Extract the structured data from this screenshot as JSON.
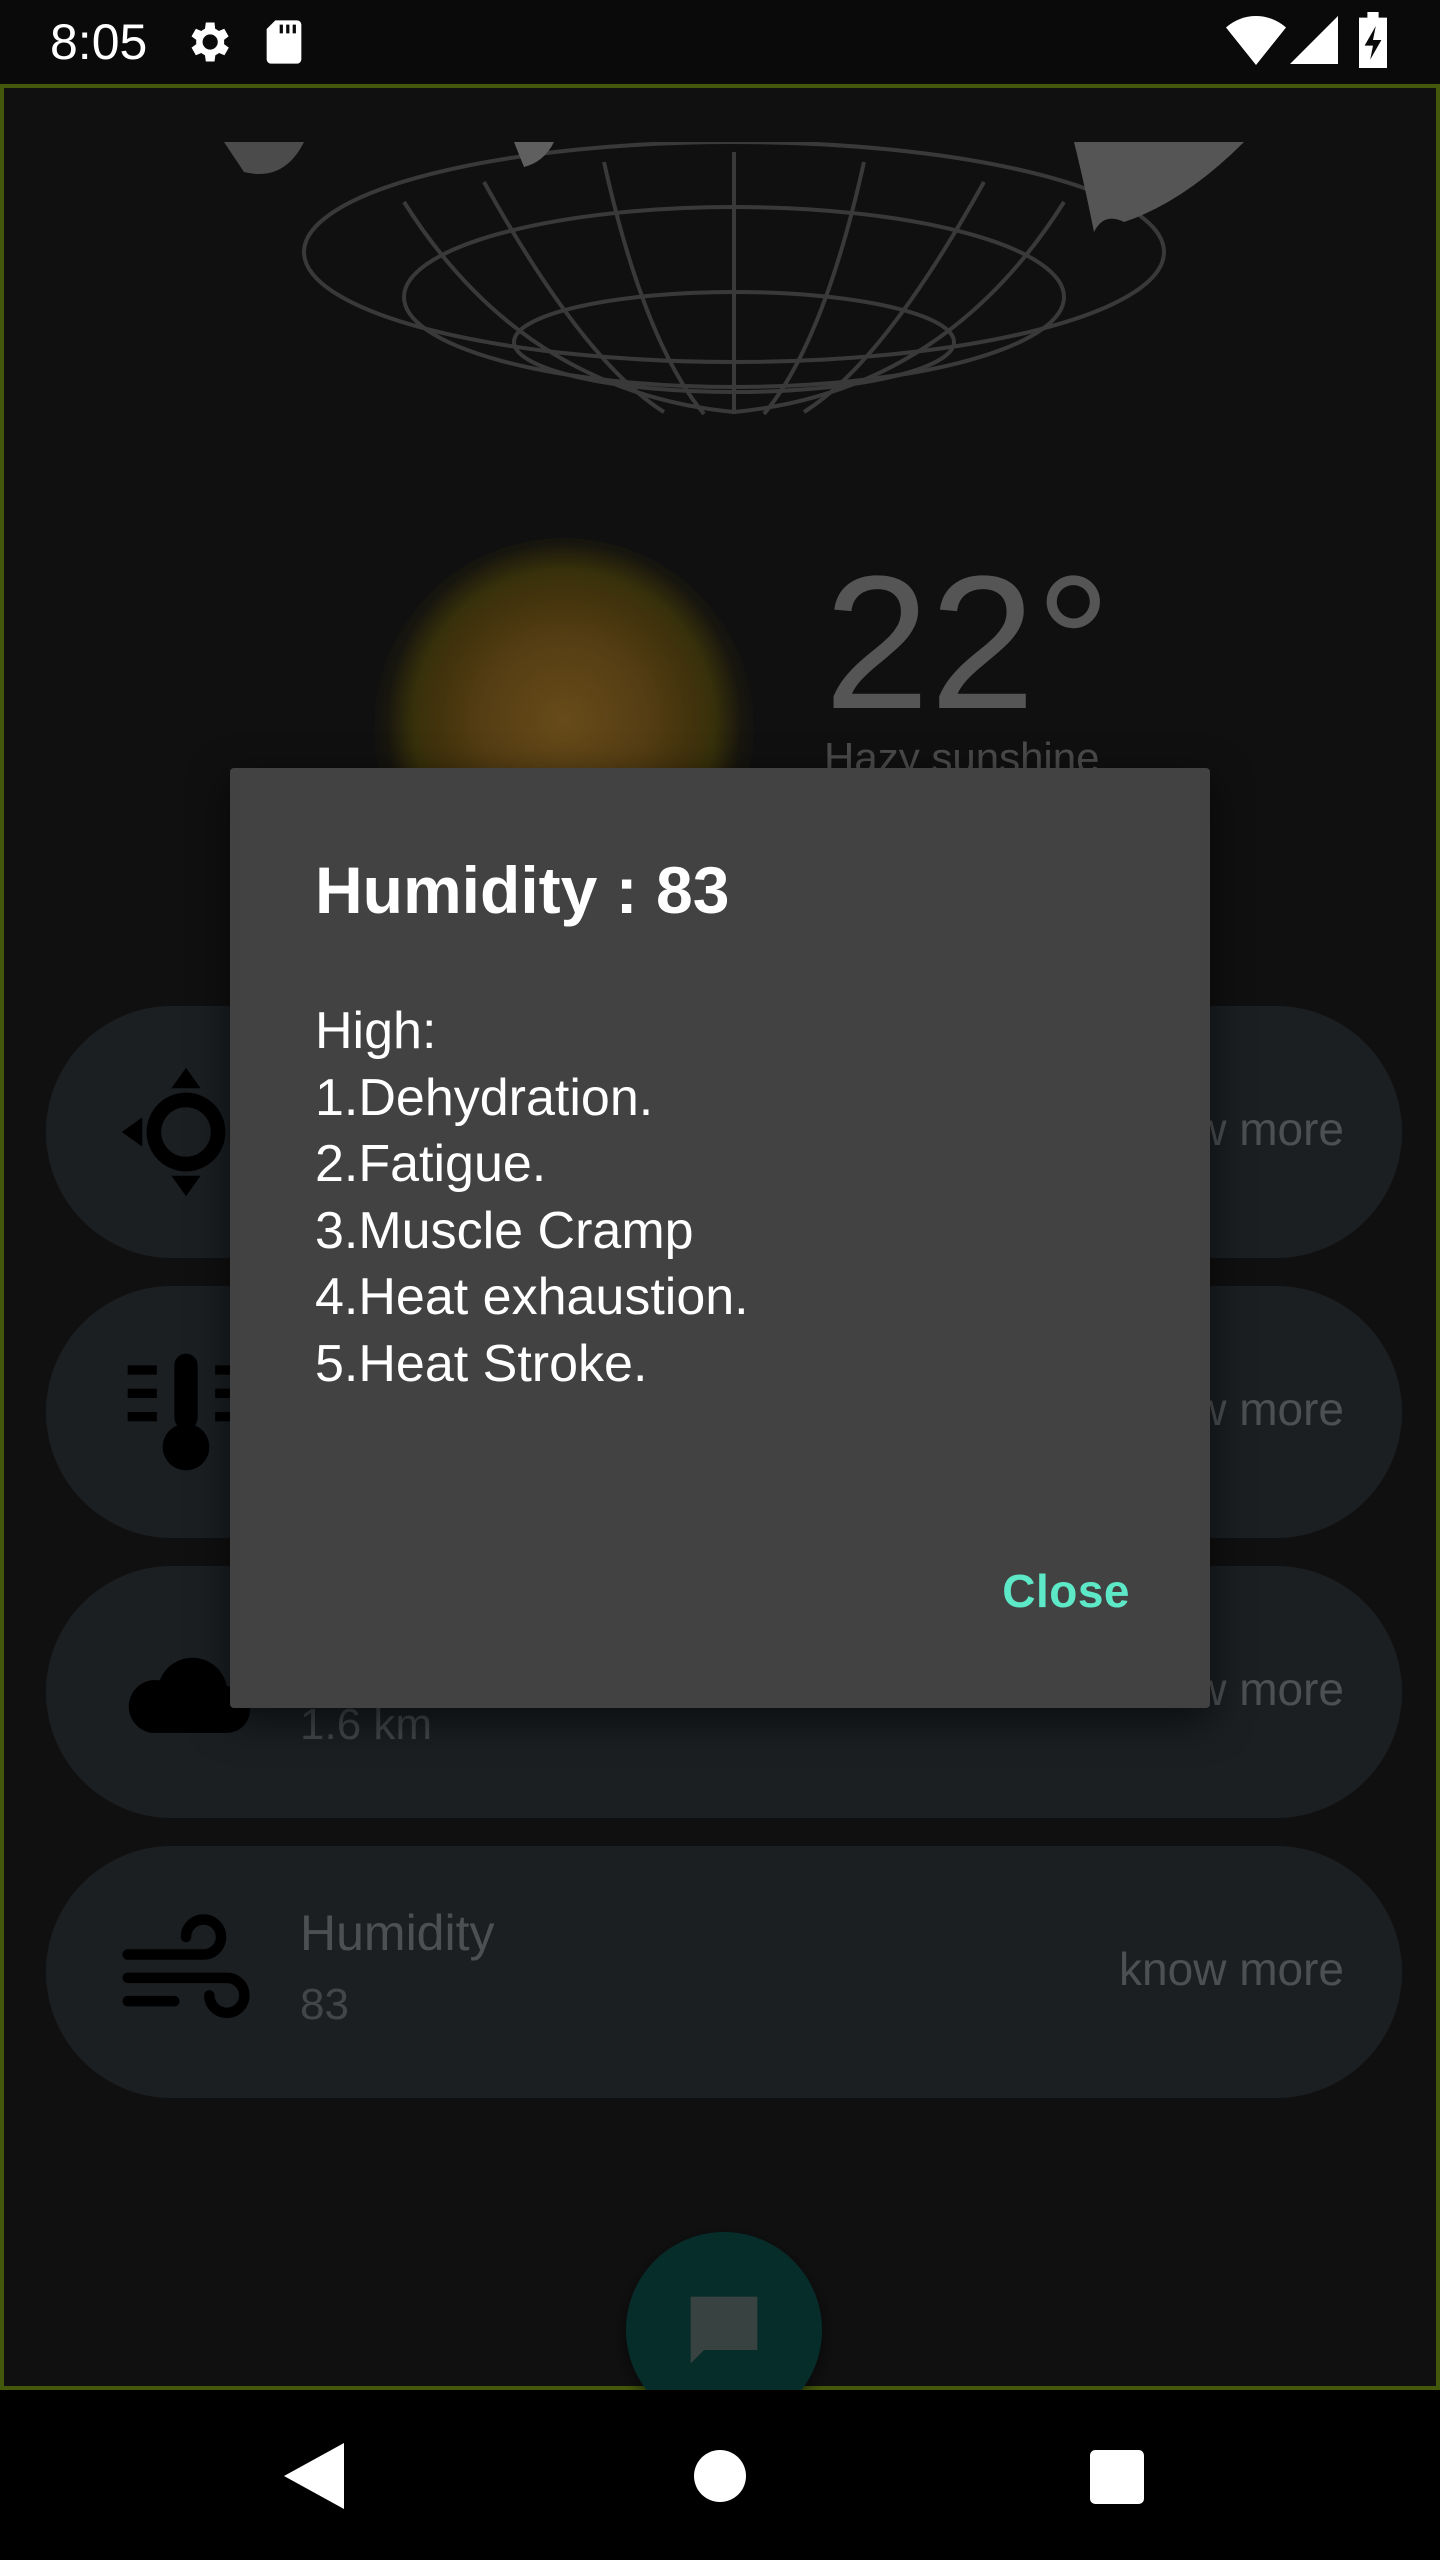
{
  "status_bar": {
    "time": "8:05",
    "icons": [
      "settings-icon",
      "sd-card-icon",
      "wifi-icon",
      "signal-icon",
      "battery-charging-icon"
    ]
  },
  "weather": {
    "temperature": "22°",
    "condition": "Hazy sunshine"
  },
  "cards": [
    {
      "title": "",
      "value": "",
      "more": "know more",
      "icon": "sun-icon"
    },
    {
      "title": "",
      "value": "",
      "more": "know more",
      "icon": "thermometer-icon"
    },
    {
      "title": "",
      "value": "1.6  km",
      "more": "know more",
      "icon": "cloud-icon"
    },
    {
      "title": "Humidity",
      "value": "83",
      "more": "know more",
      "icon": "wind-icon"
    }
  ],
  "fab": {
    "icon": "chat-icon"
  },
  "dialog": {
    "title": "Humidity : 83",
    "lines": [
      "High:",
      "1.Dehydration.",
      "2.Fatigue.",
      "3.Muscle Cramp",
      "4.Heat exhaustion.",
      "5.Heat Stroke."
    ],
    "close_label": "Close"
  },
  "nav": {
    "icons": [
      "back-icon",
      "home-icon",
      "recents-icon"
    ]
  }
}
